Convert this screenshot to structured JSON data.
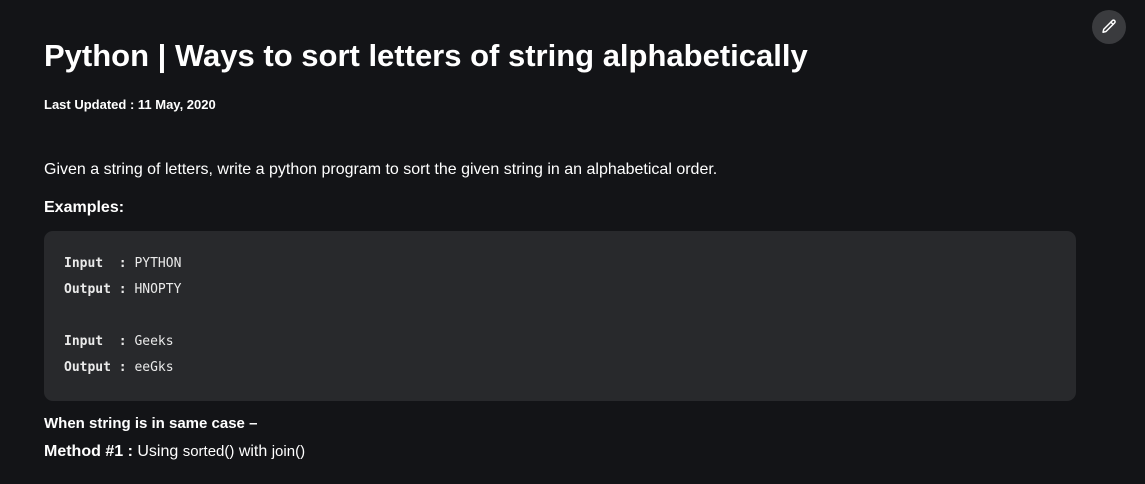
{
  "article": {
    "title": "Python | Ways to sort letters of string alphabetically",
    "last_updated": "Last Updated : 11 May, 2020",
    "intro": "Given a string of letters, write a python program to sort the given string in an alphabetical order.",
    "examples_heading": "Examples:",
    "code_examples": [
      {
        "label": "Input  :",
        "value": " PYTHON"
      },
      {
        "label": "Output :",
        "value": " HNOPTY"
      },
      {
        "label": "",
        "value": ""
      },
      {
        "label": "Input  :",
        "value": " Geeks"
      },
      {
        "label": "Output :",
        "value": " eeGks"
      }
    ],
    "same_case_heading": "When string is in same case –",
    "method1": {
      "label": "Method #1 :",
      "text_before": " Using ",
      "code1": "sorted()",
      "text_mid": " with ",
      "code2": "join()"
    }
  },
  "toolbar": {
    "edit_icon": "pencil-icon"
  },
  "colors": {
    "background": "#131417",
    "code_background": "#28292c",
    "edit_button_background": "#3a3b3e",
    "text": "#ffffff"
  }
}
